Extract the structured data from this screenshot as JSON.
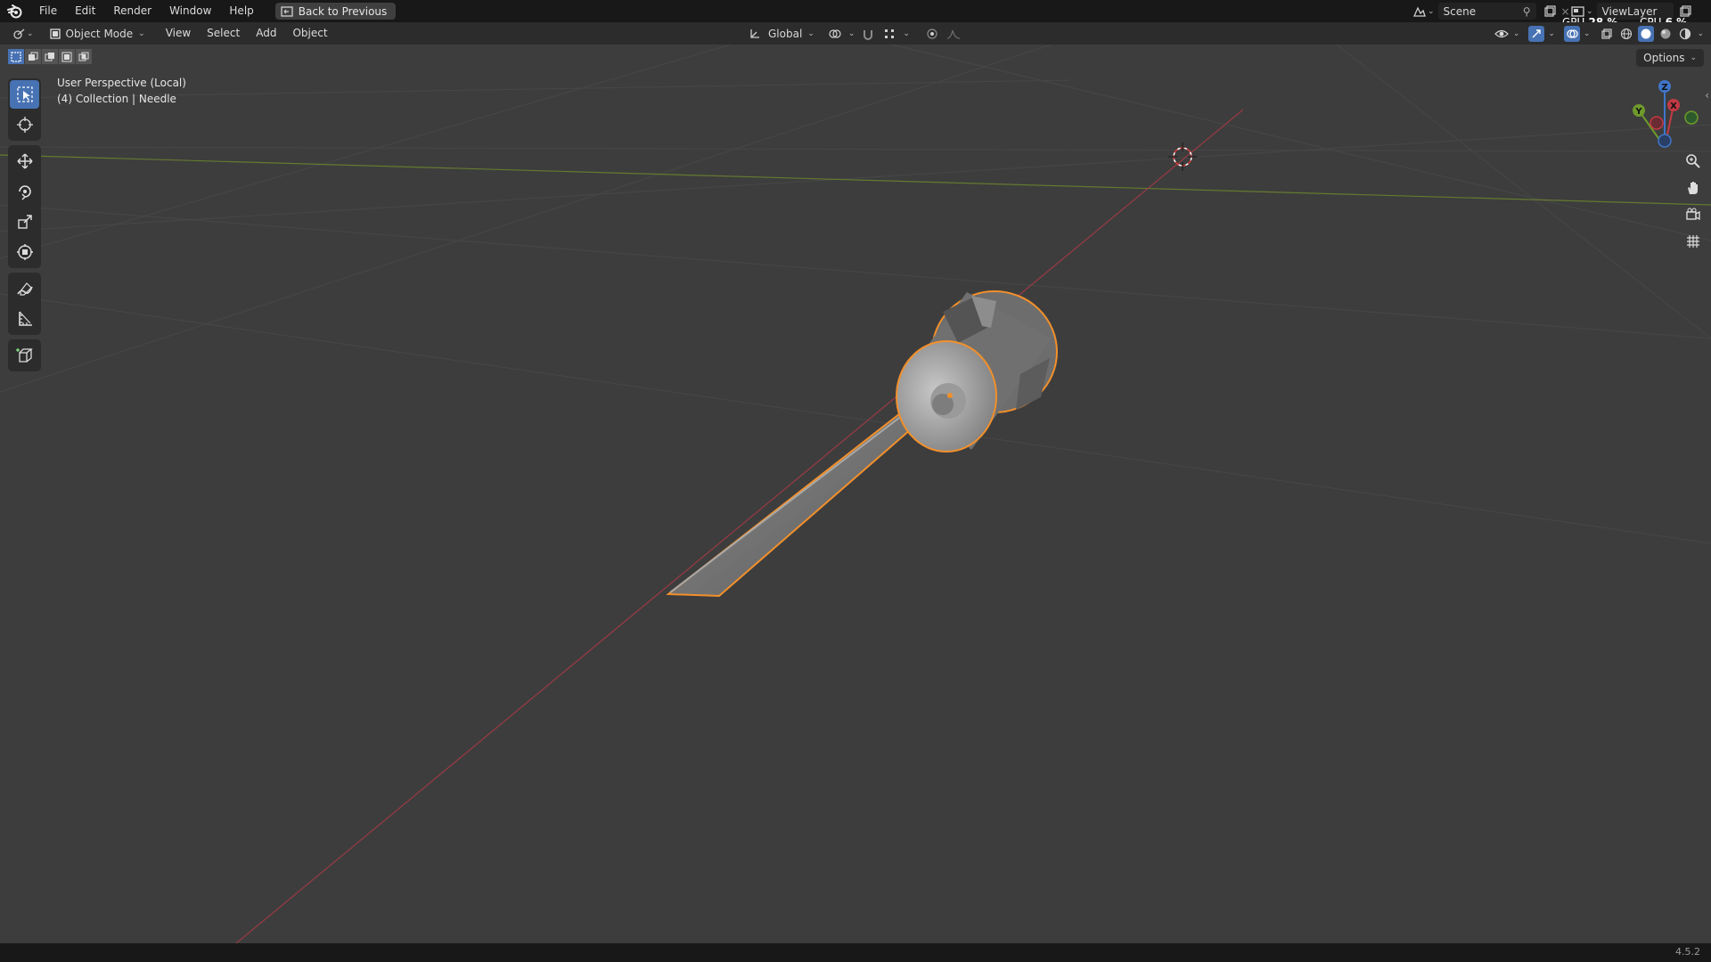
{
  "menu": {
    "items": [
      "File",
      "Edit",
      "Render",
      "Window",
      "Help"
    ],
    "back_button": "Back to Previous"
  },
  "scene": {
    "name": "Scene"
  },
  "view_layer": {
    "name": "ViewLayer"
  },
  "perf": {
    "gpu_label": "GPU",
    "gpu_value": "28 %",
    "cpu_label": "CPU",
    "cpu_value": "6 %"
  },
  "header": {
    "mode": "Object Mode",
    "menus": [
      "View",
      "Select",
      "Add",
      "Object"
    ],
    "transform_orientation": "Global"
  },
  "viewport": {
    "perspective_label": "User Perspective (Local)",
    "collection_label": "(4) Collection | Needle",
    "options_label": "Options"
  },
  "gizmo": {
    "x": "X",
    "y": "Y",
    "z": "Z"
  },
  "status": {
    "version": "4.5.2"
  },
  "colors": {
    "selection_outline": "#f2902b",
    "x_axis": "#a23a44",
    "y_axis": "#6f8a2c",
    "active_tool": "#4772b3"
  }
}
